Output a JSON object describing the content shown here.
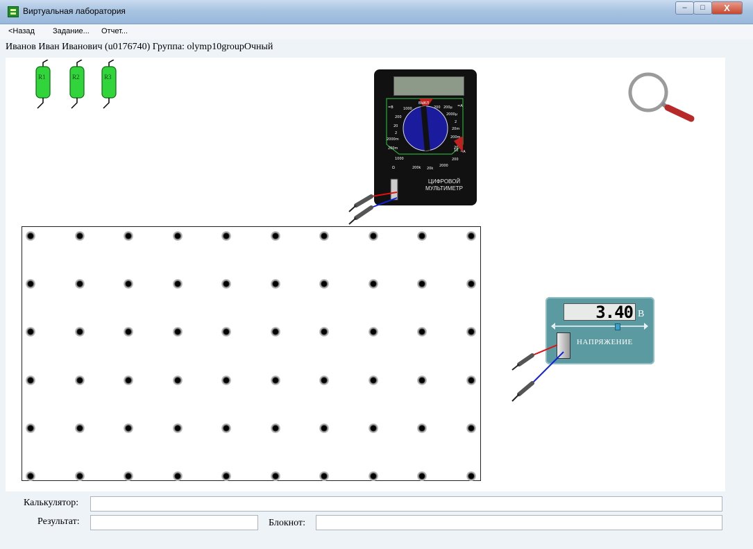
{
  "window": {
    "title": "Виртуальная лаборатория",
    "buttons": {
      "minimize": "–",
      "maximize": "□",
      "close": "X"
    }
  },
  "menu": {
    "items": [
      {
        "label": "<Назад"
      },
      {
        "label": "Задание..."
      },
      {
        "label": "Отчет..."
      }
    ]
  },
  "user": {
    "line": "Иванов Иван Иванович (u0176740)  Группа: olymp10groupОчный"
  },
  "resistors": [
    {
      "label": "R1"
    },
    {
      "label": "R2"
    },
    {
      "label": "R3"
    }
  ],
  "multimeter": {
    "label_line1": "ЦИФРОВОЙ",
    "label_line2": "МУЛЬТИМЕТР",
    "off_label": "ВЫКЛ",
    "dcv_label": "=В",
    "dca_label": "=А",
    "acv_label": "~А",
    "ohm_label": "Ω",
    "scale_labels": [
      "1000",
      "200",
      "20",
      "2",
      "200m",
      "2000m",
      "200k",
      "20k",
      "2000",
      "200",
      "20",
      "2",
      "200m",
      "10",
      "200",
      "1000",
      "200μ",
      "2000μ",
      "20m"
    ]
  },
  "voltage_source": {
    "value": "3.40",
    "unit": "В",
    "label": "НАПРЯЖЕНИЕ",
    "level_fraction": 0.7
  },
  "form": {
    "calculator_label": "Калькулятор:",
    "calculator_value": "",
    "result_label": "Результат:",
    "result_value": "",
    "notepad_label": "Блокнот:",
    "notepad_value": ""
  },
  "colors": {
    "resistor_fill": "#31d43a",
    "multimeter_dial": "#1b1b9e",
    "voltage_panel": "#5b9aa0",
    "wire_red": "#e01010",
    "wire_blue": "#1020e0",
    "magnifier_handle": "#c43030"
  },
  "icons": [
    "magnifier-icon"
  ]
}
